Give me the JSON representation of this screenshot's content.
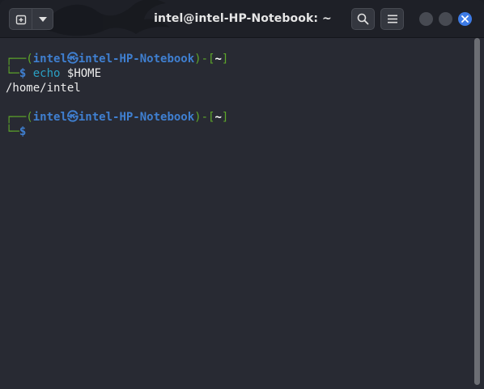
{
  "window": {
    "title": "intel@intel-HP-Notebook: ~"
  },
  "header": {
    "icons": {
      "new_tab": "new-tab-icon",
      "dropdown": "chevron-down-icon",
      "search": "search-icon",
      "menu": "hamburger-menu-icon",
      "minimize": "minimize-icon",
      "maximize": "maximize-icon",
      "close": "close-icon"
    }
  },
  "terminal": {
    "prompt1": {
      "corner": "┌──",
      "open": "(",
      "user_host": "intel㉿intel-HP-Notebook",
      "close": ")",
      "dash": "-",
      "dir_open": "[",
      "dir": "~",
      "dir_close": "]",
      "corner2": "└─",
      "dollar": "$",
      "command": "echo",
      "argument": "$HOME"
    },
    "output": "/home/intel",
    "prompt2": {
      "corner": "┌──",
      "open": "(",
      "user_host": "intel㉿intel-HP-Notebook",
      "close": ")",
      "dash": "-",
      "dir_open": "[",
      "dir": "~",
      "dir_close": "]",
      "corner2": "└─",
      "dollar": "$"
    }
  },
  "colors": {
    "prompt_frame": "#5ea82a",
    "user_host": "#3f7fd0",
    "command": "#2aa0c4",
    "close_button": "#3d7be6",
    "terminal_bg": "#282a33"
  }
}
